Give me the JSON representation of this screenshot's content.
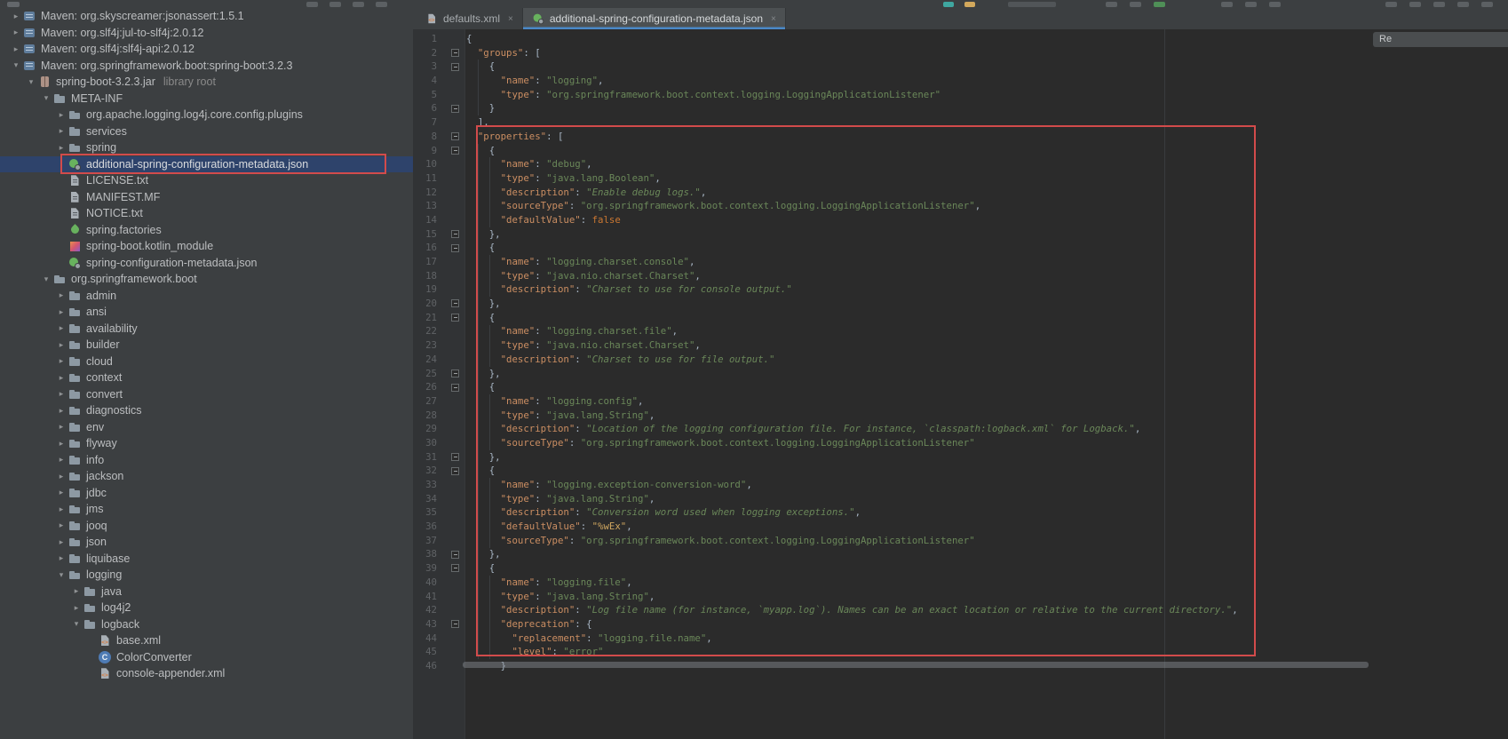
{
  "colors": {
    "accent_tab": "#4a88c7",
    "annotation": "#d24b4b",
    "key": "#cb8e62",
    "string": "#6a8759",
    "punct": "#a9b7c6",
    "keyword": "#cc7832",
    "escape": "#cfa65f",
    "selection": "#2e436b"
  },
  "sidebar": {
    "glyphs": {
      "expanded": "▾",
      "collapsed": "▸"
    },
    "items": [
      {
        "label": "Maven: org.skyscreamer:jsonassert:1.5.1",
        "level": 0,
        "state": "collapsed",
        "icon": "lib"
      },
      {
        "label": "Maven: org.slf4j:jul-to-slf4j:2.0.12",
        "level": 0,
        "state": "collapsed",
        "icon": "lib"
      },
      {
        "label": "Maven: org.slf4j:slf4j-api:2.0.12",
        "level": 0,
        "state": "collapsed",
        "icon": "lib"
      },
      {
        "label": "Maven: org.springframework.boot:spring-boot:3.2.3",
        "level": 0,
        "state": "expanded",
        "icon": "lib"
      },
      {
        "label": "spring-boot-3.2.3.jar",
        "suffix": "library root",
        "level": 1,
        "state": "expanded",
        "icon": "jar"
      },
      {
        "label": "META-INF",
        "level": 2,
        "state": "expanded",
        "icon": "folder"
      },
      {
        "label": "org.apache.logging.log4j.core.config.plugins",
        "level": 3,
        "state": "collapsed",
        "icon": "folder"
      },
      {
        "label": "services",
        "level": 3,
        "state": "collapsed",
        "icon": "folder"
      },
      {
        "label": "spring",
        "level": 3,
        "state": "collapsed",
        "icon": "folder"
      },
      {
        "label": "additional-spring-configuration-metadata.json",
        "level": 3,
        "state": "none",
        "icon": "springcfg",
        "selected": true
      },
      {
        "label": "LICENSE.txt",
        "level": 3,
        "state": "none",
        "icon": "text"
      },
      {
        "label": "MANIFEST.MF",
        "level": 3,
        "state": "none",
        "icon": "text"
      },
      {
        "label": "NOTICE.txt",
        "level": 3,
        "state": "none",
        "icon": "text"
      },
      {
        "label": "spring.factories",
        "level": 3,
        "state": "none",
        "icon": "spring"
      },
      {
        "label": "spring-boot.kotlin_module",
        "level": 3,
        "state": "none",
        "icon": "kotlin"
      },
      {
        "label": "spring-configuration-metadata.json",
        "level": 3,
        "state": "none",
        "icon": "springcfg"
      },
      {
        "label": "org.springframework.boot",
        "level": 2,
        "state": "expanded",
        "icon": "folder"
      },
      {
        "label": "admin",
        "level": 3,
        "state": "collapsed",
        "icon": "folder"
      },
      {
        "label": "ansi",
        "level": 3,
        "state": "collapsed",
        "icon": "folder"
      },
      {
        "label": "availability",
        "level": 3,
        "state": "collapsed",
        "icon": "folder"
      },
      {
        "label": "builder",
        "level": 3,
        "state": "collapsed",
        "icon": "folder"
      },
      {
        "label": "cloud",
        "level": 3,
        "state": "collapsed",
        "icon": "folder"
      },
      {
        "label": "context",
        "level": 3,
        "state": "collapsed",
        "icon": "folder"
      },
      {
        "label": "convert",
        "level": 3,
        "state": "collapsed",
        "icon": "folder"
      },
      {
        "label": "diagnostics",
        "level": 3,
        "state": "collapsed",
        "icon": "folder"
      },
      {
        "label": "env",
        "level": 3,
        "state": "collapsed",
        "icon": "folder"
      },
      {
        "label": "flyway",
        "level": 3,
        "state": "collapsed",
        "icon": "folder"
      },
      {
        "label": "info",
        "level": 3,
        "state": "collapsed",
        "icon": "folder"
      },
      {
        "label": "jackson",
        "level": 3,
        "state": "collapsed",
        "icon": "folder"
      },
      {
        "label": "jdbc",
        "level": 3,
        "state": "collapsed",
        "icon": "folder"
      },
      {
        "label": "jms",
        "level": 3,
        "state": "collapsed",
        "icon": "folder"
      },
      {
        "label": "jooq",
        "level": 3,
        "state": "collapsed",
        "icon": "folder"
      },
      {
        "label": "json",
        "level": 3,
        "state": "collapsed",
        "icon": "folder"
      },
      {
        "label": "liquibase",
        "level": 3,
        "state": "collapsed",
        "icon": "folder"
      },
      {
        "label": "logging",
        "level": 3,
        "state": "expanded",
        "icon": "folder"
      },
      {
        "label": "java",
        "level": 4,
        "state": "collapsed",
        "icon": "folder"
      },
      {
        "label": "log4j2",
        "level": 4,
        "state": "collapsed",
        "icon": "folder"
      },
      {
        "label": "logback",
        "level": 4,
        "state": "expanded",
        "icon": "folder"
      },
      {
        "label": "base.xml",
        "level": 5,
        "state": "none",
        "icon": "xml"
      },
      {
        "label": "ColorConverter",
        "level": 5,
        "state": "none",
        "icon": "class",
        "glyph": "C"
      },
      {
        "label": "console-appender.xml",
        "level": 5,
        "state": "none",
        "icon": "xml"
      }
    ]
  },
  "tabs": {
    "close_glyph": "×",
    "items": [
      {
        "label": "defaults.xml",
        "icon": "xml",
        "active": false
      },
      {
        "label": "additional-spring-configuration-metadata.json",
        "icon": "springcfg",
        "active": true
      }
    ]
  },
  "editor": {
    "overlay_text": "Re",
    "fold_lines": [
      2,
      3,
      6,
      8,
      9,
      15,
      16,
      20,
      21,
      25,
      26,
      31,
      32,
      38,
      39,
      43
    ],
    "lines": [
      {
        "n": 1,
        "t": [
          [
            "p",
            "{"
          ]
        ]
      },
      {
        "n": 2,
        "t": [
          [
            "p",
            "  "
          ],
          [
            "k",
            "\"groups\""
          ],
          [
            "p",
            ": ["
          ]
        ]
      },
      {
        "n": 3,
        "t": [
          [
            "p",
            "    {"
          ]
        ]
      },
      {
        "n": 4,
        "t": [
          [
            "p",
            "      "
          ],
          [
            "k",
            "\"name\""
          ],
          [
            "p",
            ": "
          ],
          [
            "s",
            "\"logging\""
          ],
          [
            "p",
            ","
          ]
        ]
      },
      {
        "n": 5,
        "t": [
          [
            "p",
            "      "
          ],
          [
            "k",
            "\"type\""
          ],
          [
            "p",
            ": "
          ],
          [
            "s",
            "\"org.springframework.boot.context.logging.LoggingApplicationListener\""
          ]
        ]
      },
      {
        "n": 6,
        "t": [
          [
            "p",
            "    }"
          ]
        ]
      },
      {
        "n": 7,
        "t": [
          [
            "p",
            "  ],"
          ]
        ]
      },
      {
        "n": 8,
        "t": [
          [
            "p",
            "  "
          ],
          [
            "k",
            "\"properties\""
          ],
          [
            "p",
            ": ["
          ]
        ]
      },
      {
        "n": 9,
        "t": [
          [
            "p",
            "    {"
          ]
        ]
      },
      {
        "n": 10,
        "t": [
          [
            "p",
            "      "
          ],
          [
            "k",
            "\"name\""
          ],
          [
            "p",
            ": "
          ],
          [
            "s",
            "\"debug\""
          ],
          [
            "p",
            ","
          ]
        ]
      },
      {
        "n": 11,
        "t": [
          [
            "p",
            "      "
          ],
          [
            "k",
            "\"type\""
          ],
          [
            "p",
            ": "
          ],
          [
            "s",
            "\"java.lang.Boolean\""
          ],
          [
            "p",
            ","
          ]
        ]
      },
      {
        "n": 12,
        "t": [
          [
            "p",
            "      "
          ],
          [
            "k",
            "\"description\""
          ],
          [
            "p",
            ": "
          ],
          [
            "d",
            "\"Enable debug logs.\""
          ],
          [
            "p",
            ","
          ]
        ]
      },
      {
        "n": 13,
        "t": [
          [
            "p",
            "      "
          ],
          [
            "k",
            "\"sourceType\""
          ],
          [
            "p",
            ": "
          ],
          [
            "s",
            "\"org.springframework.boot.context.logging.LoggingApplicationListener\""
          ],
          [
            "p",
            ","
          ]
        ]
      },
      {
        "n": 14,
        "t": [
          [
            "p",
            "      "
          ],
          [
            "k",
            "\"defaultValue\""
          ],
          [
            "p",
            ": "
          ],
          [
            "w",
            "false"
          ]
        ]
      },
      {
        "n": 15,
        "t": [
          [
            "p",
            "    },"
          ]
        ]
      },
      {
        "n": 16,
        "t": [
          [
            "p",
            "    {"
          ]
        ]
      },
      {
        "n": 17,
        "t": [
          [
            "p",
            "      "
          ],
          [
            "k",
            "\"name\""
          ],
          [
            "p",
            ": "
          ],
          [
            "s",
            "\"logging.charset.console\""
          ],
          [
            "p",
            ","
          ]
        ]
      },
      {
        "n": 18,
        "t": [
          [
            "p",
            "      "
          ],
          [
            "k",
            "\"type\""
          ],
          [
            "p",
            ": "
          ],
          [
            "s",
            "\"java.nio.charset.Charset\""
          ],
          [
            "p",
            ","
          ]
        ]
      },
      {
        "n": 19,
        "t": [
          [
            "p",
            "      "
          ],
          [
            "k",
            "\"description\""
          ],
          [
            "p",
            ": "
          ],
          [
            "d",
            "\"Charset to use for console output.\""
          ]
        ]
      },
      {
        "n": 20,
        "t": [
          [
            "p",
            "    },"
          ]
        ]
      },
      {
        "n": 21,
        "t": [
          [
            "p",
            "    {"
          ]
        ]
      },
      {
        "n": 22,
        "t": [
          [
            "p",
            "      "
          ],
          [
            "k",
            "\"name\""
          ],
          [
            "p",
            ": "
          ],
          [
            "s",
            "\"logging.charset.file\""
          ],
          [
            "p",
            ","
          ]
        ]
      },
      {
        "n": 23,
        "t": [
          [
            "p",
            "      "
          ],
          [
            "k",
            "\"type\""
          ],
          [
            "p",
            ": "
          ],
          [
            "s",
            "\"java.nio.charset.Charset\""
          ],
          [
            "p",
            ","
          ]
        ]
      },
      {
        "n": 24,
        "t": [
          [
            "p",
            "      "
          ],
          [
            "k",
            "\"description\""
          ],
          [
            "p",
            ": "
          ],
          [
            "d",
            "\"Charset to use for file output.\""
          ]
        ]
      },
      {
        "n": 25,
        "t": [
          [
            "p",
            "    },"
          ]
        ]
      },
      {
        "n": 26,
        "t": [
          [
            "p",
            "    {"
          ]
        ]
      },
      {
        "n": 27,
        "t": [
          [
            "p",
            "      "
          ],
          [
            "k",
            "\"name\""
          ],
          [
            "p",
            ": "
          ],
          [
            "s",
            "\"logging.config\""
          ],
          [
            "p",
            ","
          ]
        ]
      },
      {
        "n": 28,
        "t": [
          [
            "p",
            "      "
          ],
          [
            "k",
            "\"type\""
          ],
          [
            "p",
            ": "
          ],
          [
            "s",
            "\"java.lang.String\""
          ],
          [
            "p",
            ","
          ]
        ]
      },
      {
        "n": 29,
        "t": [
          [
            "p",
            "      "
          ],
          [
            "k",
            "\"description\""
          ],
          [
            "p",
            ": "
          ],
          [
            "d",
            "\"Location of the logging configuration file. For instance, `classpath:logback.xml` for Logback.\""
          ],
          [
            "p",
            ","
          ]
        ]
      },
      {
        "n": 30,
        "t": [
          [
            "p",
            "      "
          ],
          [
            "k",
            "\"sourceType\""
          ],
          [
            "p",
            ": "
          ],
          [
            "s",
            "\"org.springframework.boot.context.logging.LoggingApplicationListener\""
          ]
        ]
      },
      {
        "n": 31,
        "t": [
          [
            "p",
            "    },"
          ]
        ]
      },
      {
        "n": 32,
        "t": [
          [
            "p",
            "    {"
          ]
        ]
      },
      {
        "n": 33,
        "t": [
          [
            "p",
            "      "
          ],
          [
            "k",
            "\"name\""
          ],
          [
            "p",
            ": "
          ],
          [
            "s",
            "\"logging.exception-conversion-word\""
          ],
          [
            "p",
            ","
          ]
        ]
      },
      {
        "n": 34,
        "t": [
          [
            "p",
            "      "
          ],
          [
            "k",
            "\"type\""
          ],
          [
            "p",
            ": "
          ],
          [
            "s",
            "\"java.lang.String\""
          ],
          [
            "p",
            ","
          ]
        ]
      },
      {
        "n": 35,
        "t": [
          [
            "p",
            "      "
          ],
          [
            "k",
            "\"description\""
          ],
          [
            "p",
            ": "
          ],
          [
            "d",
            "\"Conversion word used when logging exceptions.\""
          ],
          [
            "p",
            ","
          ]
        ]
      },
      {
        "n": 36,
        "t": [
          [
            "p",
            "      "
          ],
          [
            "k",
            "\"defaultValue\""
          ],
          [
            "p",
            ": "
          ],
          [
            "e",
            "\"%wEx\""
          ],
          [
            "p",
            ","
          ]
        ]
      },
      {
        "n": 37,
        "t": [
          [
            "p",
            "      "
          ],
          [
            "k",
            "\"sourceType\""
          ],
          [
            "p",
            ": "
          ],
          [
            "s",
            "\"org.springframework.boot.context.logging.LoggingApplicationListener\""
          ]
        ]
      },
      {
        "n": 38,
        "t": [
          [
            "p",
            "    },"
          ]
        ]
      },
      {
        "n": 39,
        "t": [
          [
            "p",
            "    {"
          ]
        ]
      },
      {
        "n": 40,
        "t": [
          [
            "p",
            "      "
          ],
          [
            "k",
            "\"name\""
          ],
          [
            "p",
            ": "
          ],
          [
            "s",
            "\"logging.file\""
          ],
          [
            "p",
            ","
          ]
        ]
      },
      {
        "n": 41,
        "t": [
          [
            "p",
            "      "
          ],
          [
            "k",
            "\"type\""
          ],
          [
            "p",
            ": "
          ],
          [
            "s",
            "\"java.lang.String\""
          ],
          [
            "p",
            ","
          ]
        ]
      },
      {
        "n": 42,
        "t": [
          [
            "p",
            "      "
          ],
          [
            "k",
            "\"description\""
          ],
          [
            "p",
            ": "
          ],
          [
            "d",
            "\"Log file name (for instance, `myapp.log`). Names can be an exact location or relative to the current directory.\""
          ],
          [
            "p",
            ","
          ]
        ]
      },
      {
        "n": 43,
        "t": [
          [
            "p",
            "      "
          ],
          [
            "k",
            "\"deprecation\""
          ],
          [
            "p",
            ": {"
          ]
        ]
      },
      {
        "n": 44,
        "t": [
          [
            "p",
            "        "
          ],
          [
            "k",
            "\"replacement\""
          ],
          [
            "p",
            ": "
          ],
          [
            "s",
            "\"logging.file.name\""
          ],
          [
            "p",
            ","
          ]
        ]
      },
      {
        "n": 45,
        "t": [
          [
            "p",
            "        "
          ],
          [
            "k",
            "\"level\""
          ],
          [
            "p",
            ": "
          ],
          [
            "s",
            "\"error\""
          ]
        ]
      },
      {
        "n": 46,
        "t": [
          [
            "p",
            "      }"
          ]
        ]
      }
    ]
  }
}
